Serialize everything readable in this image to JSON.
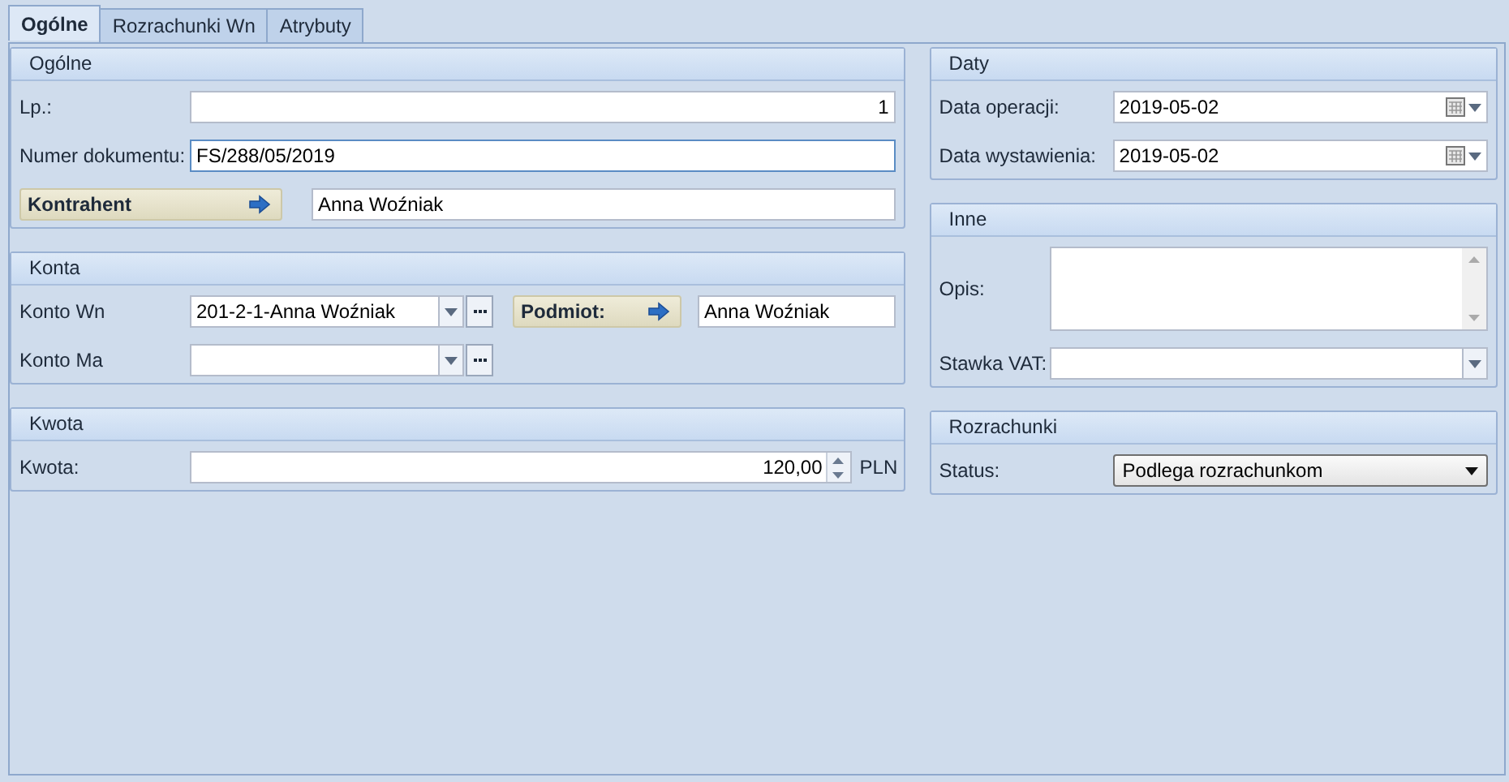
{
  "tabs": [
    {
      "label": "Ogólne",
      "selected": true
    },
    {
      "label": "Rozrachunki Wn",
      "selected": false
    },
    {
      "label": "Atrybuty",
      "selected": false
    }
  ],
  "left": [
    {
      "title": "Ogólne",
      "rows": [
        {
          "kind": "number",
          "label": "Lp.:",
          "value": "1"
        },
        {
          "kind": "text",
          "label": "Numer dokumentu:",
          "value": "FS/288/05/2019",
          "focused": true
        },
        {
          "kind": "link",
          "label": "Kontrahent",
          "value": "Anna Woźniak"
        }
      ]
    },
    {
      "title": "Konta",
      "rows": [
        {
          "kind": "account",
          "label": "Konto Wn",
          "value": "201-2-1-Anna Woźniak",
          "link": {
            "label": "Podmiot:",
            "value": "Anna Woźniak"
          }
        },
        {
          "kind": "account",
          "label": "Konto Ma"
        }
      ]
    },
    {
      "title": "Kwota",
      "rows": [
        {
          "kind": "amount",
          "label": "Kwota:",
          "value": "120,00",
          "unit": "PLN"
        }
      ]
    }
  ],
  "right": [
    {
      "title": "Daty",
      "rows": [
        {
          "kind": "date",
          "label": "Data operacji:",
          "value": "2019-05-02"
        },
        {
          "kind": "date",
          "label": "Data wystawienia:",
          "value": "2019-05-02"
        }
      ]
    },
    {
      "title": "Inne",
      "rows": [
        {
          "kind": "memo",
          "label": "Opis:"
        },
        {
          "kind": "combo",
          "label": "Stawka VAT:"
        }
      ]
    },
    {
      "title": "Rozrachunki",
      "rows": [
        {
          "kind": "select",
          "label": "Status:",
          "value": "Podlega rozrachunkom"
        }
      ]
    }
  ]
}
